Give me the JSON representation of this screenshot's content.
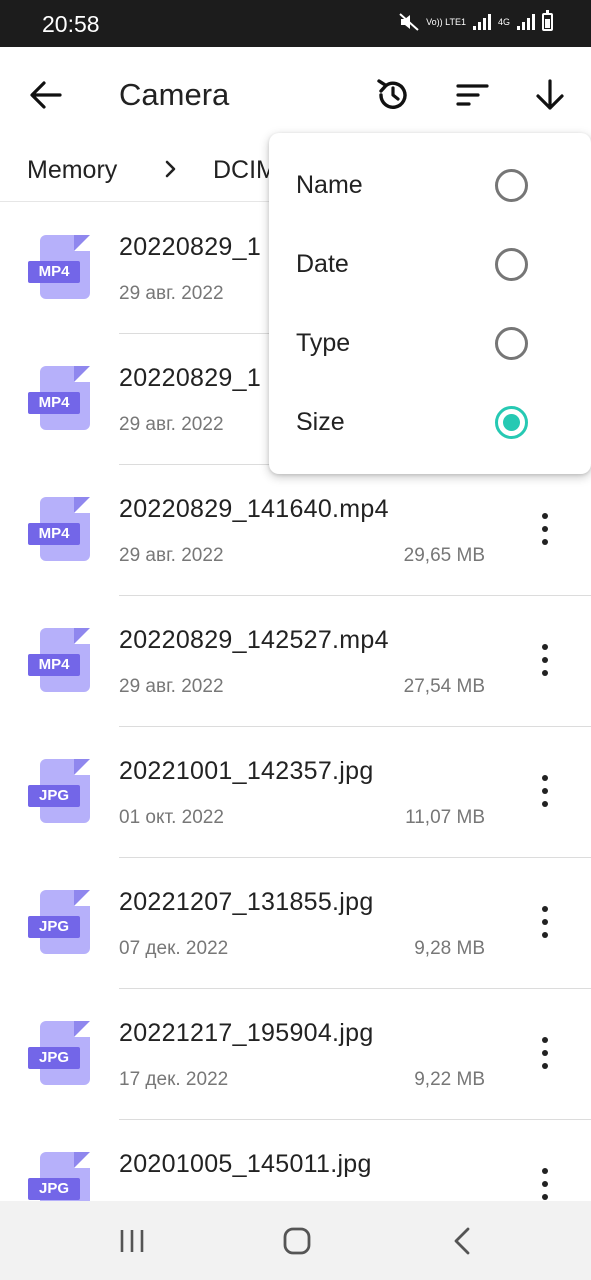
{
  "status_bar": {
    "time": "20:58",
    "volte_label": "Vo)) LTE1",
    "network_label": "4G"
  },
  "app_bar": {
    "title": "Camera",
    "icons": [
      "back-arrow-icon",
      "refresh-icon",
      "sort-icon",
      "download-arrow-icon"
    ]
  },
  "breadcrumb": {
    "items": [
      "Memory",
      "DCIM"
    ],
    "separator_icon": "chevron-right-icon"
  },
  "files": [
    {
      "name": "20220829_1",
      "date": "29 авг. 2022",
      "size": "",
      "type": "MP4"
    },
    {
      "name": "20220829_1",
      "date": "29 авг. 2022",
      "size": "",
      "type": "MP4"
    },
    {
      "name": "20220829_141640.mp4",
      "date": "29 авг. 2022",
      "size": "29,65 MB",
      "type": "MP4"
    },
    {
      "name": "20220829_142527.mp4",
      "date": "29 авг. 2022",
      "size": "27,54 MB",
      "type": "MP4"
    },
    {
      "name": "20221001_142357.jpg",
      "date": "01 окт. 2022",
      "size": "11,07 MB",
      "type": "JPG"
    },
    {
      "name": "20221207_131855.jpg",
      "date": "07 дек. 2022",
      "size": "9,28 MB",
      "type": "JPG"
    },
    {
      "name": "20221217_195904.jpg",
      "date": "17 дек. 2022",
      "size": "9,22 MB",
      "type": "JPG"
    },
    {
      "name": "20201005_145011.jpg",
      "date": "",
      "size": "",
      "type": "JPG"
    }
  ],
  "sort_menu": {
    "options": [
      {
        "label": "Name",
        "selected": false
      },
      {
        "label": "Date",
        "selected": false
      },
      {
        "label": "Type",
        "selected": false
      },
      {
        "label": "Size",
        "selected": true
      }
    ],
    "accent_color": "#26c9b3"
  },
  "colors": {
    "file_icon": "#b6b0fa",
    "file_tag": "#7366e8",
    "status_bar": "#1c1c1c"
  },
  "nav_bar": {
    "icons": [
      "recents-icon",
      "home-icon",
      "back-icon"
    ]
  }
}
